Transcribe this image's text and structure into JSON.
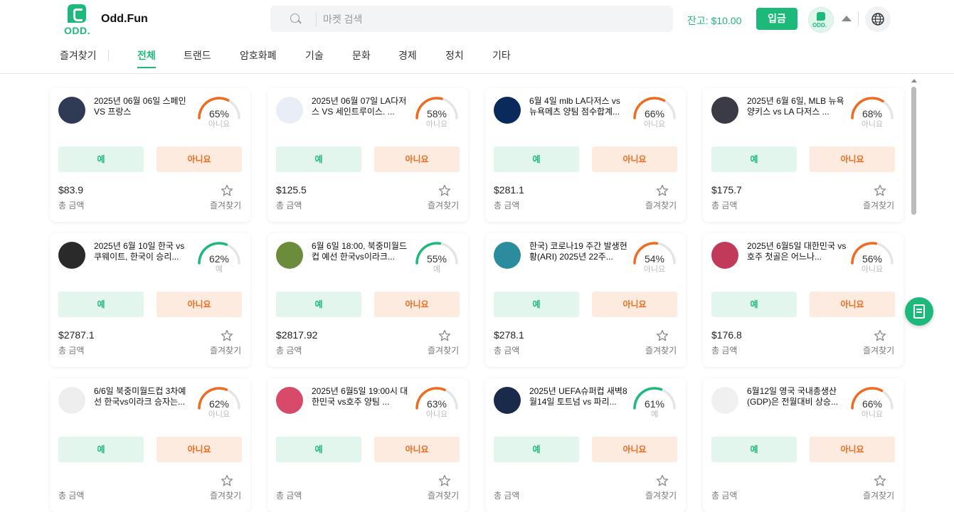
{
  "header": {
    "logo_text": "ODD.",
    "brand": "Odd.Fun",
    "search_placeholder": "마켓 검색",
    "balance": "잔고: $10.00",
    "deposit_label": "입금",
    "avatar_text": "ODD."
  },
  "nav": {
    "favorites": "즐겨찾기",
    "tabs": [
      "전체",
      "트랜드",
      "암호화폐",
      "기술",
      "문화",
      "경제",
      "정치",
      "기타"
    ],
    "active_tab": "전체"
  },
  "common": {
    "yes": "예",
    "no": "아니요",
    "amount_label": "총 금액",
    "favorite_label": "즐겨찾기"
  },
  "colors": {
    "accent": "#1db97a",
    "no": "#f06a1f"
  },
  "cards": [
    {
      "title": "2025년 06월 06일 스페인 VS 프랑스",
      "pct": "65%",
      "pct_value": 65,
      "label": "아니요",
      "amount": "$83.9",
      "thumb": "#2f3a55"
    },
    {
      "title": "2025년 06월 07일 LA다저스 VS 세인트루이스. ...",
      "pct": "58%",
      "pct_value": 58,
      "label": "아니요",
      "amount": "$125.5",
      "thumb": "#e9eef6"
    },
    {
      "title": "6월 4일 mlb LA다저스 vs 뉴욕메츠 양팀 점수합계...",
      "pct": "66%",
      "pct_value": 66,
      "label": "아니요",
      "amount": "$281.1",
      "thumb": "#0a2a5c"
    },
    {
      "title": "2025년 6월 6일, MLB 뉴욕 양키스 vs LA 다저스 ...",
      "pct": "68%",
      "pct_value": 68,
      "label": "아니요",
      "amount": "$175.7",
      "thumb": "#3b3b48"
    },
    {
      "title": "2025년 6월 10일 한국 vs 쿠웨이트, 한국이 승리...",
      "pct": "62%",
      "pct_value": 62,
      "label": "예",
      "amount": "$2787.1",
      "thumb": "#2a2a2a"
    },
    {
      "title": "6월 6일 18:00, 북중미월드컵 예선 한국vs이라크...",
      "pct": "55%",
      "pct_value": 55,
      "label": "예",
      "amount": "$2817.92",
      "thumb": "#6b8c3a"
    },
    {
      "title": "한국) 코로나19 주간 발생현황(ARI) 2025년 22주...",
      "pct": "54%",
      "pct_value": 54,
      "label": "아니요",
      "amount": "$278.1",
      "thumb": "#2a8c9c"
    },
    {
      "title": "2025년 6월5일 대한민국 vs 호주 첫골은 어느나...",
      "pct": "56%",
      "pct_value": 56,
      "label": "아니요",
      "amount": "$176.8",
      "thumb": "#c23a5a"
    },
    {
      "title": "6/6일 북중미월드컵 3차예선 한국vs이라크 승자는...",
      "pct": "62%",
      "pct_value": 62,
      "label": "아니요",
      "amount": "",
      "thumb": "#eeeeee"
    },
    {
      "title": "2025년 6월5일 19:00시 대한민국 vs호주 양팀 ...",
      "pct": "63%",
      "pct_value": 63,
      "label": "아니요",
      "amount": "",
      "thumb": "#d84a6a"
    },
    {
      "title": "2025년 UEFA슈퍼컵 새벽8월14일 토트넘 vs 파리...",
      "pct": "61%",
      "pct_value": 61,
      "label": "예",
      "amount": "",
      "thumb": "#1a2a4a"
    },
    {
      "title": "6월12일 영국 국내총생산(GDP)은 전월대비 상승...",
      "pct": "66%",
      "pct_value": 66,
      "label": "아니요",
      "amount": "",
      "thumb": "#f0f0f0"
    }
  ]
}
